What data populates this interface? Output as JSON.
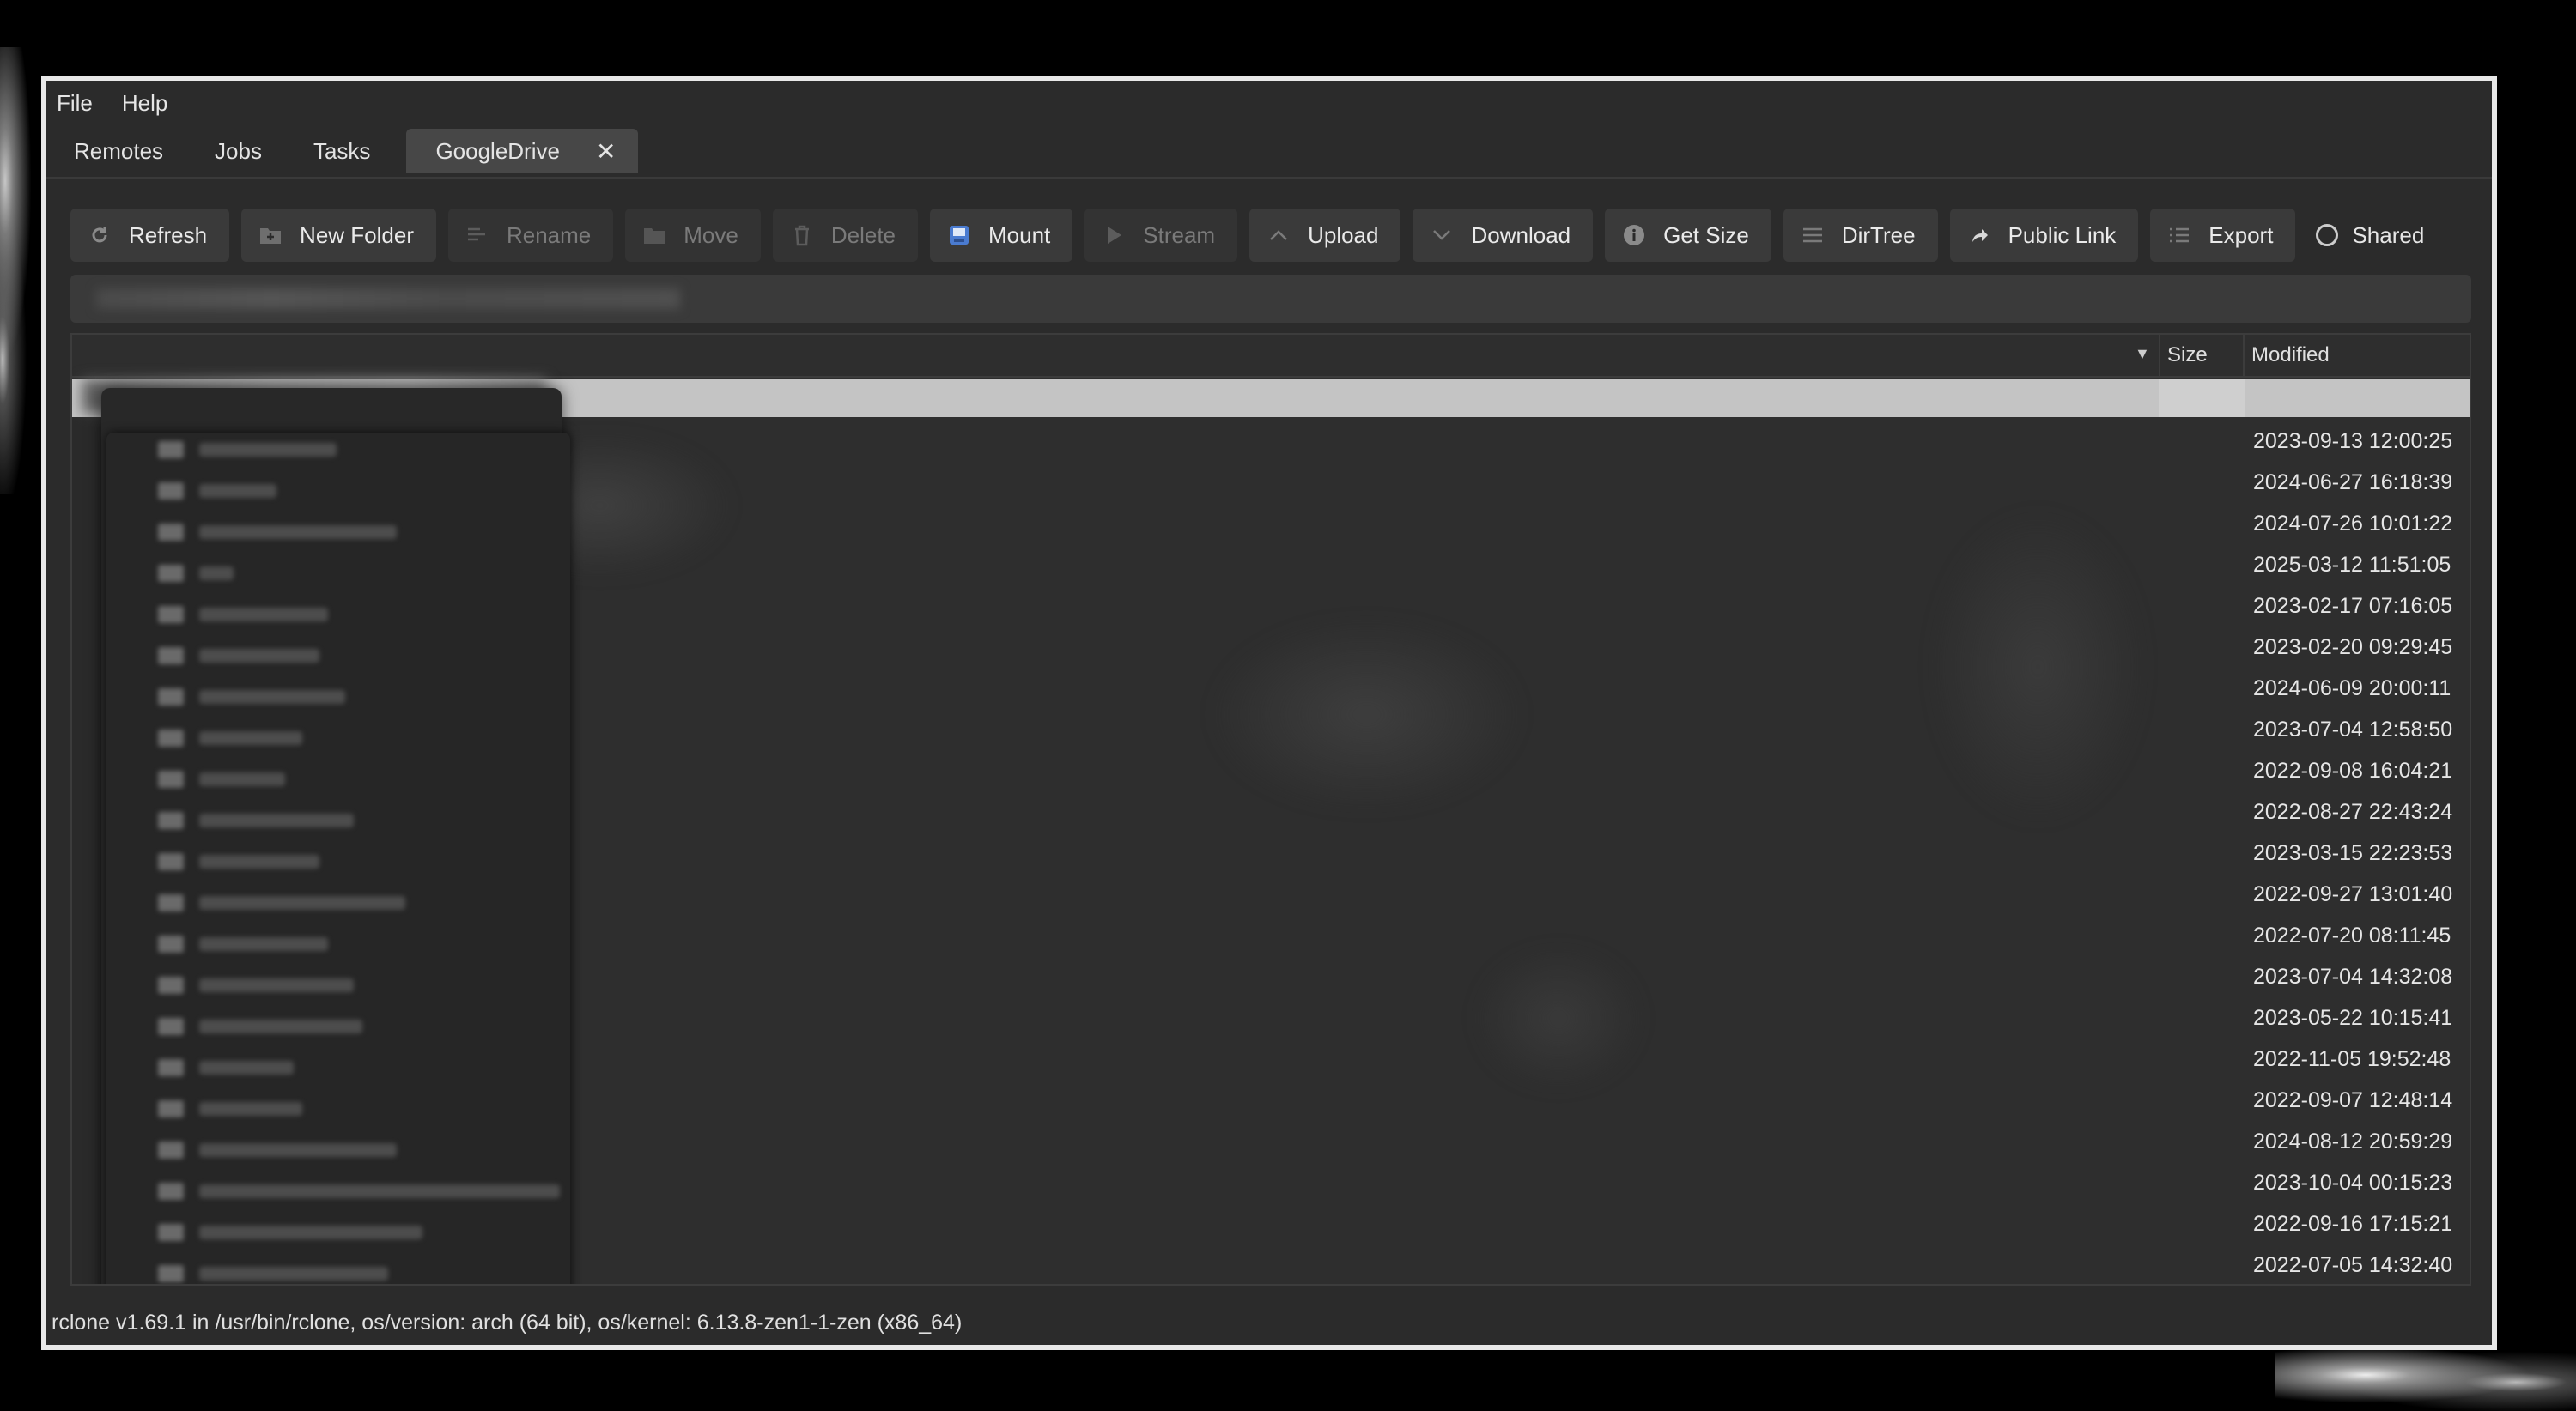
{
  "menu": {
    "file": "File",
    "help": "Help"
  },
  "tabs": {
    "remotes": "Remotes",
    "jobs": "Jobs",
    "tasks": "Tasks",
    "active": "GoogleDrive",
    "close_glyph": "✕"
  },
  "toolbar": {
    "refresh": "Refresh",
    "new_folder": "New Folder",
    "rename": "Rename",
    "move": "Move",
    "delete": "Delete",
    "mount": "Mount",
    "stream": "Stream",
    "upload": "Upload",
    "download": "Download",
    "get_size": "Get Size",
    "dirtree": "DirTree",
    "public_link": "Public Link",
    "export": "Export",
    "shared": "Shared"
  },
  "columns": {
    "size": "Size",
    "modified": "Modified"
  },
  "files": {
    "modified": [
      "2023-09-13 12:00:25",
      "2024-06-27 16:18:39",
      "2024-07-26 10:01:22",
      "2025-03-12 11:51:05",
      "2023-02-17 07:16:05",
      "2023-02-20 09:29:45",
      "2024-06-09 20:00:11",
      "2023-07-04 12:58:50",
      "2022-09-08 16:04:21",
      "2022-08-27 22:43:24",
      "2023-03-15 22:23:53",
      "2022-09-27 13:01:40",
      "2022-07-20 08:11:45",
      "2023-07-04 14:32:08",
      "2023-05-22 10:15:41",
      "2022-11-05 19:52:48",
      "2022-09-07 12:48:14",
      "2024-08-12 20:59:29",
      "2023-10-04 00:15:23",
      "2022-09-16 17:15:21",
      "2022-07-05 14:32:40"
    ]
  },
  "status": "rclone v1.69.1 in /usr/bin/rclone, os/version: arch (64 bit), os/kernel: 6.13.8-zen1-1-zen (x86_64)"
}
